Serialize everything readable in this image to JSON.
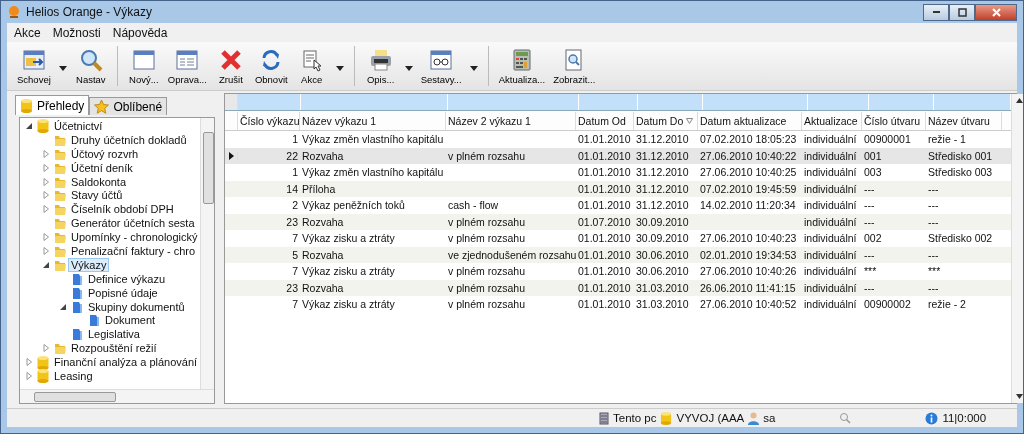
{
  "window": {
    "title": "Helios Orange - Výkazy"
  },
  "menu": [
    "Akce",
    "Možnosti",
    "Nápověda"
  ],
  "toolbar": {
    "groups": [
      [
        {
          "label": "Schovej",
          "kind": "panel",
          "dropdown": true
        },
        {
          "label": "Nastav",
          "kind": "search",
          "dropdown": false
        }
      ],
      [
        {
          "label": "Nový...",
          "kind": "window",
          "dropdown": false
        },
        {
          "label": "Oprava...",
          "kind": "form",
          "dropdown": false
        },
        {
          "label": "Zrušit",
          "kind": "delete",
          "dropdown": false
        },
        {
          "label": "Obnovit",
          "kind": "refresh",
          "dropdown": false
        },
        {
          "label": "Akce",
          "kind": "pointer",
          "dropdown": true
        }
      ],
      [
        {
          "label": "Opis...",
          "kind": "printer",
          "dropdown": true
        },
        {
          "label": "Sestavy...",
          "kind": "glasses",
          "dropdown": true
        }
      ],
      [
        {
          "label": "Aktualiza...",
          "kind": "calculator",
          "dropdown": false
        },
        {
          "label": "Zobrazit...",
          "kind": "preview",
          "dropdown": false
        }
      ]
    ]
  },
  "sidebar": {
    "tabs": [
      {
        "label": "Přehledy",
        "kind": "database",
        "selected": true
      },
      {
        "label": "Oblíbené",
        "kind": "star",
        "selected": false
      }
    ],
    "tree": [
      {
        "label": "Účetnictví",
        "kind": "database",
        "expandable": true,
        "expanded": true,
        "selected": false,
        "children": [
          {
            "label": "Druhy účetních dokladů",
            "kind": "folder",
            "expandable": false,
            "selected": false
          },
          {
            "label": "Účtový rozvrh",
            "kind": "folder",
            "expandable": true,
            "expanded": false,
            "selected": false
          },
          {
            "label": "Účetní deník",
            "kind": "folder",
            "expandable": true,
            "expanded": false,
            "selected": false
          },
          {
            "label": "Saldokonta",
            "kind": "folder",
            "expandable": true,
            "expanded": false,
            "selected": false
          },
          {
            "label": "Stavy účtů",
            "kind": "folder",
            "expandable": true,
            "expanded": false,
            "selected": false
          },
          {
            "label": "Číselník období DPH",
            "kind": "folder",
            "expandable": true,
            "expanded": false,
            "selected": false
          },
          {
            "label": "Generátor účetních sesta",
            "kind": "folder",
            "expandable": false,
            "selected": false
          },
          {
            "label": "Upomínky - chronologický",
            "kind": "folder",
            "expandable": true,
            "expanded": false,
            "selected": false
          },
          {
            "label": "Penalizační faktury - chro",
            "kind": "folder",
            "expandable": true,
            "expanded": false,
            "selected": false
          },
          {
            "label": "Výkazy",
            "kind": "folder",
            "expandable": true,
            "expanded": true,
            "selected": true,
            "children": [
              {
                "label": "Definice výkazu",
                "kind": "document",
                "expandable": false,
                "selected": false
              },
              {
                "label": "Popisné údaje",
                "kind": "document",
                "expandable": false,
                "selected": false
              },
              {
                "label": "Skupiny dokumentů",
                "kind": "document",
                "expandable": true,
                "expanded": true,
                "selected": false,
                "children": [
                  {
                    "label": "Dokument",
                    "kind": "document",
                    "expandable": false,
                    "selected": false
                  }
                ]
              },
              {
                "label": "Legislativa",
                "kind": "document",
                "expandable": false,
                "selected": false
              }
            ]
          },
          {
            "label": "Rozpouštění režií",
            "kind": "folder",
            "expandable": true,
            "expanded": false,
            "selected": false
          }
        ]
      },
      {
        "label": "Finanční analýza a plánování",
        "kind": "database",
        "expandable": true,
        "expanded": false,
        "selected": false
      },
      {
        "label": "Leasing",
        "kind": "database",
        "expandable": true,
        "expanded": false,
        "selected": false
      }
    ]
  },
  "table": {
    "columns": [
      {
        "label": "Číslo výkazu",
        "sorted": false
      },
      {
        "label": "Název výkazu 1",
        "sorted": false
      },
      {
        "label": "Název 2 výkazu 1",
        "sorted": false
      },
      {
        "label": "Datum Od",
        "sorted": false
      },
      {
        "label": "Datum Do",
        "sorted": true
      },
      {
        "label": "Datum aktualizace",
        "sorted": false
      },
      {
        "label": "Aktualizace",
        "sorted": false
      },
      {
        "label": "Číslo útvaru",
        "sorted": false
      },
      {
        "label": "Název útvaru",
        "sorted": false
      }
    ],
    "rows": [
      {
        "current": false,
        "cells": [
          "1",
          "Výkaz změn vlastního kapitálu",
          "",
          "01.01.2010",
          "31.12.2010",
          "07.02.2010 18:05:23",
          "individuální",
          "00900001",
          "režie - 1"
        ]
      },
      {
        "current": true,
        "cells": [
          "22",
          "Rozvaha",
          "v plném rozsahu",
          "01.01.2010",
          "31.12.2010",
          "27.06.2010 10:40:22",
          "individuální",
          "001",
          "Středisko 001"
        ]
      },
      {
        "current": false,
        "cells": [
          "1",
          "Výkaz změn vlastního kapitálu",
          "",
          "01.01.2010",
          "31.12.2010",
          "27.06.2010 10:40:25",
          "individuální",
          "003",
          "Středisko 003"
        ]
      },
      {
        "current": false,
        "cells": [
          "14",
          "Příloha",
          "",
          "01.01.2010",
          "31.12.2010",
          "07.02.2010 19:45:59",
          "individuální",
          "---",
          "---"
        ]
      },
      {
        "current": false,
        "cells": [
          "2",
          "Výkaz peněžních toků",
          "cash - flow",
          "01.01.2010",
          "31.12.2010",
          "14.02.2010 11:20:34",
          "individuální",
          "---",
          "---"
        ]
      },
      {
        "current": false,
        "cells": [
          "23",
          "Rozvaha",
          "v plném rozsahu",
          "01.07.2010",
          "30.09.2010",
          "",
          "individuální",
          "---",
          "---"
        ]
      },
      {
        "current": false,
        "cells": [
          "7",
          "Výkaz zisku a ztráty",
          "v plném rozsahu",
          "01.01.2010",
          "30.09.2010",
          "27.06.2010 10:40:23",
          "individuální",
          "002",
          "Středisko 002"
        ]
      },
      {
        "current": false,
        "cells": [
          "5",
          "Rozvaha",
          "ve zjednodušeném rozsahu",
          "01.01.2010",
          "30.06.2010",
          "02.01.2010 19:34:53",
          "individuální",
          "---",
          "---"
        ]
      },
      {
        "current": false,
        "cells": [
          "7",
          "Výkaz zisku a ztráty",
          "v plném rozsahu",
          "01.01.2010",
          "30.06.2010",
          "27.06.2010 10:40:26",
          "individuální",
          "***",
          "***"
        ]
      },
      {
        "current": false,
        "cells": [
          "23",
          "Rozvaha",
          "v plném rozsahu",
          "01.01.2010",
          "31.03.2010",
          "26.06.2010 11:41:15",
          "individuální",
          "---",
          "---"
        ]
      },
      {
        "current": false,
        "cells": [
          "7",
          "Výkaz zisku a ztráty",
          "v plném rozsahu",
          "01.01.2010",
          "31.03.2010",
          "27.06.2010 10:40:52",
          "individuální",
          "00900002",
          "režie - 2"
        ]
      }
    ]
  },
  "status_bar": {
    "computer": "Tento pc",
    "database": "VYVOJ (AAA",
    "user": "sa",
    "counter": "11|0:000"
  }
}
